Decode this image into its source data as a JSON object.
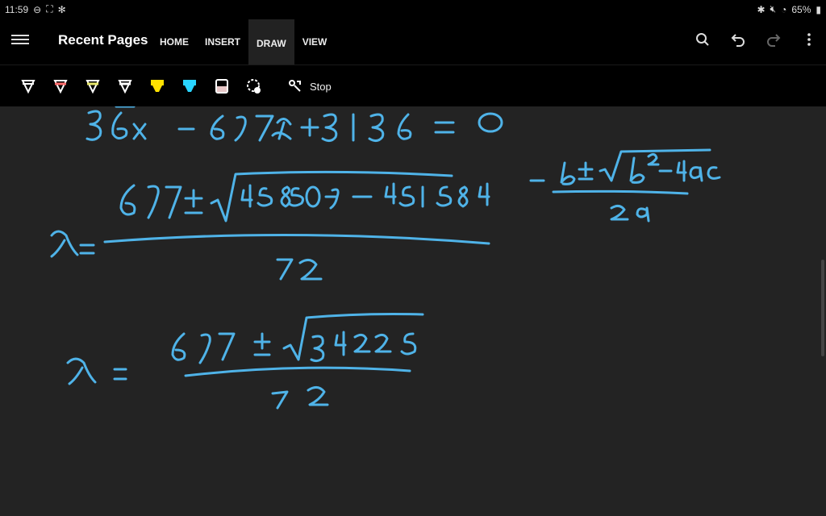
{
  "status": {
    "time": "11:59",
    "battery": "65%"
  },
  "app": {
    "title": "Recent Pages",
    "tabs": [
      {
        "label": "HOME"
      },
      {
        "label": "INSERT"
      },
      {
        "label": "DRAW",
        "active": true
      },
      {
        "label": "VIEW"
      }
    ]
  },
  "toolbar": {
    "pens": [
      {
        "name": "pen-white",
        "color": "#ffffff"
      },
      {
        "name": "pen-red",
        "color": "#ff6b6b"
      },
      {
        "name": "pen-yellow",
        "color": "#e6e66a"
      },
      {
        "name": "pen-white-2",
        "color": "#ffffff"
      },
      {
        "name": "highlighter-yellow",
        "color": "#ffe100"
      },
      {
        "name": "highlighter-cyan",
        "color": "#29d4ff"
      },
      {
        "name": "eraser",
        "color": "#e8c8c8"
      },
      {
        "name": "lasso",
        "color": "#ffffff"
      }
    ],
    "stop_label": "Stop"
  },
  "ink": {
    "color": "#4fb3e8"
  }
}
